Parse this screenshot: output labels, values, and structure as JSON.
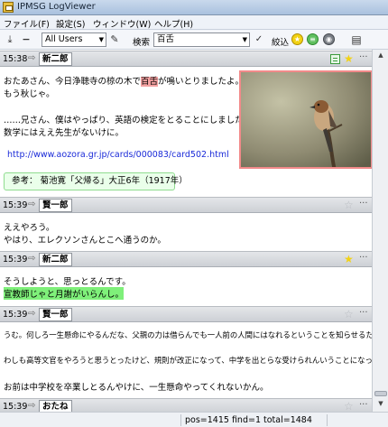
{
  "window": {
    "title": "IPMSG LogViewer"
  },
  "menu": [
    {
      "label": "ファイル(F)"
    },
    {
      "label": "設定(S)"
    },
    {
      "label": "ウィンドウ(W)"
    },
    {
      "label": "ヘルプ(H)"
    }
  ],
  "toolbar": {
    "user_filter": "All Users",
    "search_label": "検索",
    "search_value": "百舌",
    "narrow_label": "絞込"
  },
  "colors": {
    "highlight_search": "#f4a2a2",
    "highlight_marker": "#7ff07a",
    "star_on": "#f2d214",
    "link": "#1a2ad8"
  },
  "messages": [
    {
      "time": "15:38",
      "sender": "新二郎",
      "starred": true,
      "memo": true,
      "line1_pre": "おたあさん、今日浄聴寺の椋の木で",
      "line1_hl": "百舌",
      "line1_post": "が鳴いとりましたよ。",
      "line2": "もう秋じゃ。",
      "line3": "……兄さん、僕はやっぱり、英語の検定をとることにしました。",
      "line4": "数学にはええ先生がないけに。",
      "link": "http://www.aozora.gr.jp/cards/000083/card502.html",
      "reference": "参考：  菊池寛「父帰る」大正6年（1917年）"
    },
    {
      "time": "15:39",
      "sender": "賢一郎",
      "starred": false,
      "line1": "ええやろう。",
      "line2": "やはり、エレクソンさんとこへ通うのか。"
    },
    {
      "time": "15:39",
      "sender": "新二郎",
      "starred": true,
      "line1": "そうしようと、思っとるんです。",
      "line2": "宣教師じゃと月謝がいらんし。"
    },
    {
      "time": "15:39",
      "sender": "賢一郎",
      "starred": false,
      "line1": "うむ。何しろ一生懸命にやるんだな、父親の力は借らんでも一人前の人間にはなれるということを知らせるために、勉強するんじゃな。",
      "line2": "わしも高等文官をやろうと思うとったけど、規則が改正になって、中学を出とらな受けられんいうことになったから、諦めとんや。",
      "line3": "お前は中学校を卒業しとるんやけに、一生懸命やってくれないかん。"
    },
    {
      "time": "15:39",
      "sender": "おたね",
      "starred": false
    }
  ],
  "status": "pos=1415 find=1 total=1484"
}
